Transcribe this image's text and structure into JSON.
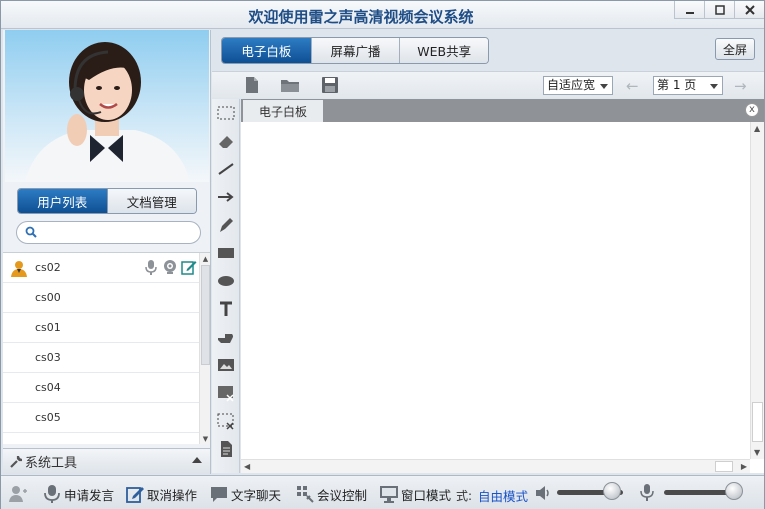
{
  "window": {
    "title": "欢迎使用雷之声高清视频会议系统",
    "min_icon": "minimize-icon",
    "max_icon": "maximize-icon",
    "close_icon": "close-icon"
  },
  "left_panel": {
    "tabs": [
      {
        "label": "用户列表",
        "active": true
      },
      {
        "label": "文档管理",
        "active": false
      }
    ],
    "search": {
      "placeholder": "",
      "value": ""
    },
    "users": [
      {
        "name": "cs02",
        "has_avatar": true,
        "icons": [
          "microphone-icon",
          "camera-icon",
          "edit-icon"
        ]
      },
      {
        "name": "cs00"
      },
      {
        "name": "cs01"
      },
      {
        "name": "cs03"
      },
      {
        "name": "cs04"
      },
      {
        "name": "cs05"
      }
    ],
    "system_tools": "系统工具"
  },
  "main": {
    "tabs": [
      {
        "label": "电子白板",
        "active": true
      },
      {
        "label": "屏幕广播",
        "active": false
      },
      {
        "label": "WEB共享",
        "active": false
      }
    ],
    "fullscreen_label": "全屏",
    "zoom_select": "自适应宽",
    "page_select": "第 1 页",
    "board_tab": "电子白板",
    "board_close": "x"
  },
  "bottom_bar": {
    "request_speak": "申请发言",
    "cancel_operation": "取消操作",
    "text_chat": "文字聊天",
    "meeting_control": "会议控制",
    "window_mode": "窗口模式",
    "mode_prefix": "式:",
    "mode_value": "自由模式",
    "speaker_volume": 0.85,
    "mic_volume": 1.0
  },
  "colors": {
    "accent": "#1a5ea8",
    "mode_link": "#1a53c8"
  }
}
